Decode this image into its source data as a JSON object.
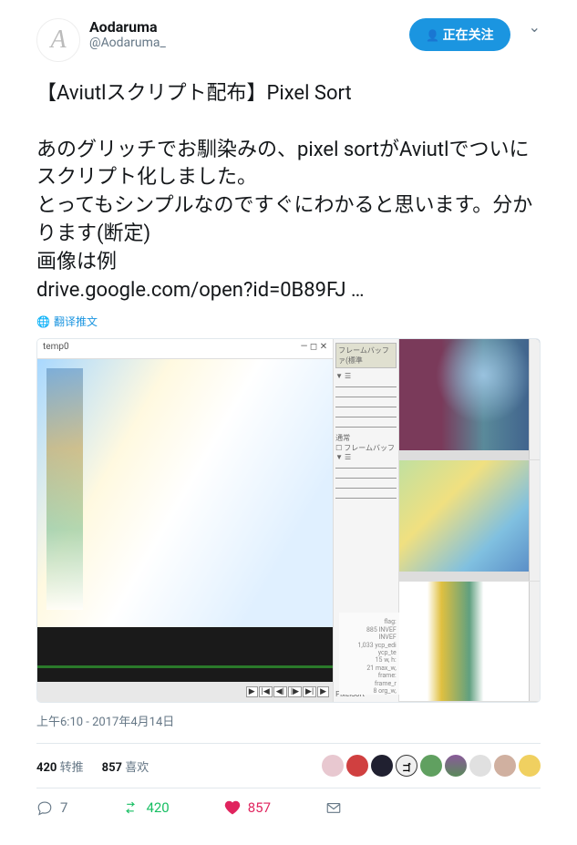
{
  "user": {
    "display_name": "Aodaruma",
    "handle": "@Aodaruma_",
    "avatar_letter": "A"
  },
  "follow_button": "正在关注",
  "tweet_text": "【Aviutlスクリプト配布】Pixel Sort\n\nあのグリッチでお馴染みの、pixel sortがAviutlでついにスクリプト化しました。\nとってもシンプルなのですぐにわかると思います。分かります(断定)\n画像は例\ndrive.google.com/open?id=0B89FJ …",
  "translate_label": "翻译推文",
  "media": {
    "window_title": "temp0",
    "panel_title": "フレームバッファ(標準",
    "panel_mode": "通常",
    "panel_sub": "フレームバッフ",
    "script_name": "PixelSort",
    "controls": [
      "▶",
      "|◀",
      "◀|",
      "|▶",
      "▶|",
      "▶"
    ],
    "side_numbers": [
      "885",
      "1,033",
      "15",
      "8",
      "21"
    ],
    "side_labels": [
      "flag:",
      "INVEF",
      "INVEF",
      "ycp_edi",
      "ycp_te",
      "w, h:",
      "max_w,",
      "frame:",
      "frame_r",
      "org_w,"
    ]
  },
  "timestamp": "上午6:10 - 2017年4月14日",
  "stats": {
    "retweets_count": "420",
    "retweets_label": "转推",
    "likes_count": "857",
    "likes_label": "喜欢"
  },
  "actions": {
    "reply_count": "7",
    "retweet_count": "420",
    "like_count": "857"
  }
}
